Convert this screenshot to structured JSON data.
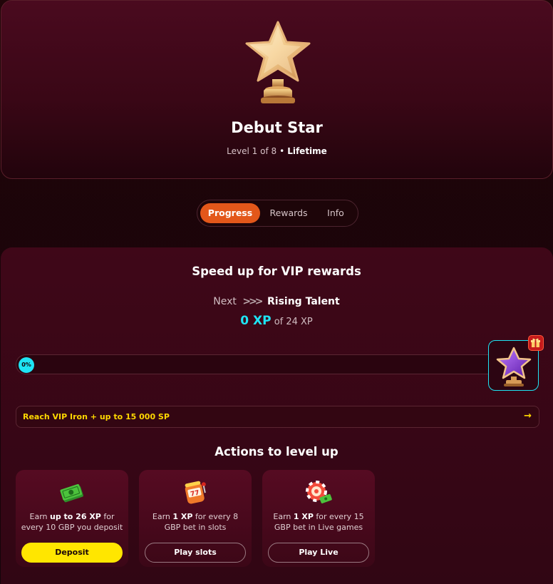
{
  "level": {
    "title": "Debut Star",
    "level_text": "Level 1 of 8",
    "separator": "•",
    "period": "Lifetime",
    "trophy_icon": "gold-star-trophy-icon"
  },
  "tabs": [
    {
      "label": "Progress",
      "active": true
    },
    {
      "label": "Rewards",
      "active": false
    },
    {
      "label": "Info",
      "active": false
    }
  ],
  "progress": {
    "title": "Speed up for VIP rewards",
    "next_label": "Next",
    "next_chevrons": ">>>",
    "next_name": "Rising Talent",
    "xp_current": "0 XP",
    "xp_of": "of 24 XP",
    "percent_label": "0%",
    "percent_value": 0,
    "next_badge_icon": "purple-star-trophy-icon",
    "gift_icon": "gift-icon"
  },
  "reach_banner": {
    "text": "Reach VIP Iron + up to 15 000 SP",
    "arrow": "→"
  },
  "actions": {
    "title": "Actions to level up",
    "cards": [
      {
        "icon": "cash-stack-icon",
        "text_pre": "Earn ",
        "text_bold": "up to 26 XP",
        "text_post": " for every 10 GBP you deposit",
        "button": "Deposit"
      },
      {
        "icon": "slot-machine-icon",
        "text_pre": "Earn ",
        "text_bold": "1 XP",
        "text_post": " for every 8 GBP bet in slots",
        "button": "Play slots"
      },
      {
        "icon": "roulette-chip-icon",
        "text_pre": "Earn ",
        "text_bold": "1 XP",
        "text_post": " for every 15 GBP bet in Live games",
        "button": "Play Live"
      }
    ]
  },
  "colors": {
    "accent_orange": "#e3571a",
    "accent_cyan": "#1ee4f4",
    "accent_yellow": "#ffe600",
    "background": "#1a0508"
  }
}
